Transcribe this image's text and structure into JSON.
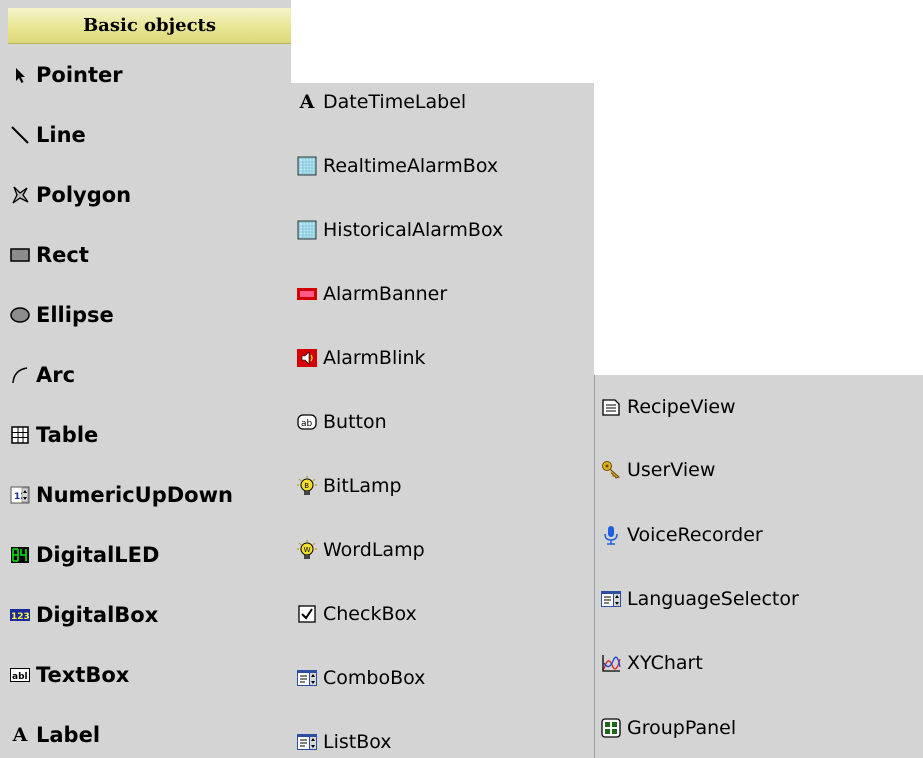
{
  "panel_title": "Basic objects",
  "basic_objects": [
    {
      "label": "Pointer",
      "icon": "pointer-arrow-icon"
    },
    {
      "label": "Line",
      "icon": "line-icon"
    },
    {
      "label": "Polygon",
      "icon": "polygon-icon"
    },
    {
      "label": "Rect",
      "icon": "rectangle-icon"
    },
    {
      "label": "Ellipse",
      "icon": "ellipse-icon"
    },
    {
      "label": "Arc",
      "icon": "arc-icon"
    },
    {
      "label": "Table",
      "icon": "table-grid-icon"
    },
    {
      "label": "NumericUpDown",
      "icon": "numeric-updown-icon"
    },
    {
      "label": "DigitalLED",
      "icon": "digital-led-icon"
    },
    {
      "label": "DigitalBox",
      "icon": "digital-box-icon"
    },
    {
      "label": "TextBox",
      "icon": "textbox-icon"
    },
    {
      "label": "Label",
      "icon": "label-a-icon"
    }
  ],
  "controls": [
    {
      "label": "DateTimeLabel",
      "icon": "datetime-label-a-icon"
    },
    {
      "label": "RealtimeAlarmBox",
      "icon": "realtime-alarm-box-icon"
    },
    {
      "label": "HistoricalAlarmBox",
      "icon": "historical-alarm-box-icon"
    },
    {
      "label": "AlarmBanner",
      "icon": "alarm-banner-icon"
    },
    {
      "label": "AlarmBlink",
      "icon": "alarm-blink-icon"
    },
    {
      "label": "Button",
      "icon": "button-ab-icon"
    },
    {
      "label": "BitLamp",
      "icon": "bit-lamp-bulb-icon"
    },
    {
      "label": "WordLamp",
      "icon": "word-lamp-bulb-icon"
    },
    {
      "label": "CheckBox",
      "icon": "checkbox-icon"
    },
    {
      "label": "ComboBox",
      "icon": "combobox-icon"
    },
    {
      "label": "ListBox",
      "icon": "listbox-icon"
    }
  ],
  "advanced": [
    {
      "label": "RecipeView",
      "icon": "recipe-view-icon"
    },
    {
      "label": "UserView",
      "icon": "user-view-key-icon"
    },
    {
      "label": "VoiceRecorder",
      "icon": "microphone-icon"
    },
    {
      "label": "LanguageSelector",
      "icon": "language-selector-icon"
    },
    {
      "label": "XYChart",
      "icon": "xy-chart-icon"
    },
    {
      "label": "GroupPanel",
      "icon": "group-panel-icon"
    }
  ],
  "colors": {
    "panel_bg": "#d4d4d4",
    "header_bg": "#e7e490",
    "led_green": "#00d000",
    "alarm_red": "#d40000",
    "blue_box": "#1a2a9a",
    "lamp_yellow": "#f4e02a"
  }
}
